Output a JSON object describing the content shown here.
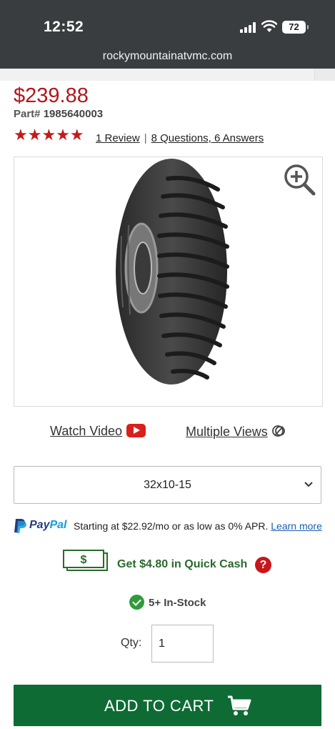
{
  "status_bar": {
    "time": "12:52",
    "battery": "72"
  },
  "browser": {
    "url": "rockymountainatvmc.com"
  },
  "product": {
    "price": "$239.88",
    "part_label": "Part#",
    "part_number": "1985640003",
    "stars": "★★★★★",
    "review_link": "1 Review",
    "separator": "|",
    "qa_link": "8 Questions, 6 Answers"
  },
  "media": {
    "watch_video": "Watch Video",
    "multiple_views": "Multiple Views"
  },
  "size_select": {
    "selected": "32x10-15"
  },
  "paypal": {
    "brand_pay": "Pay",
    "brand_pal": "Pal",
    "desc": "Starting at $22.92/mo or as low as 0% APR.",
    "learn_more": "Learn more"
  },
  "quick_cash": {
    "text": "Get $4.80 in Quick Cash",
    "help": "?"
  },
  "stock": {
    "text": "5+ In-Stock"
  },
  "quantity": {
    "label": "Qty:",
    "value": "1"
  },
  "cart": {
    "label": "ADD TO CART"
  },
  "colors": {
    "price_red": "#b4151b",
    "cart_green": "#0e6b34",
    "cash_green": "#2a6a2c"
  }
}
